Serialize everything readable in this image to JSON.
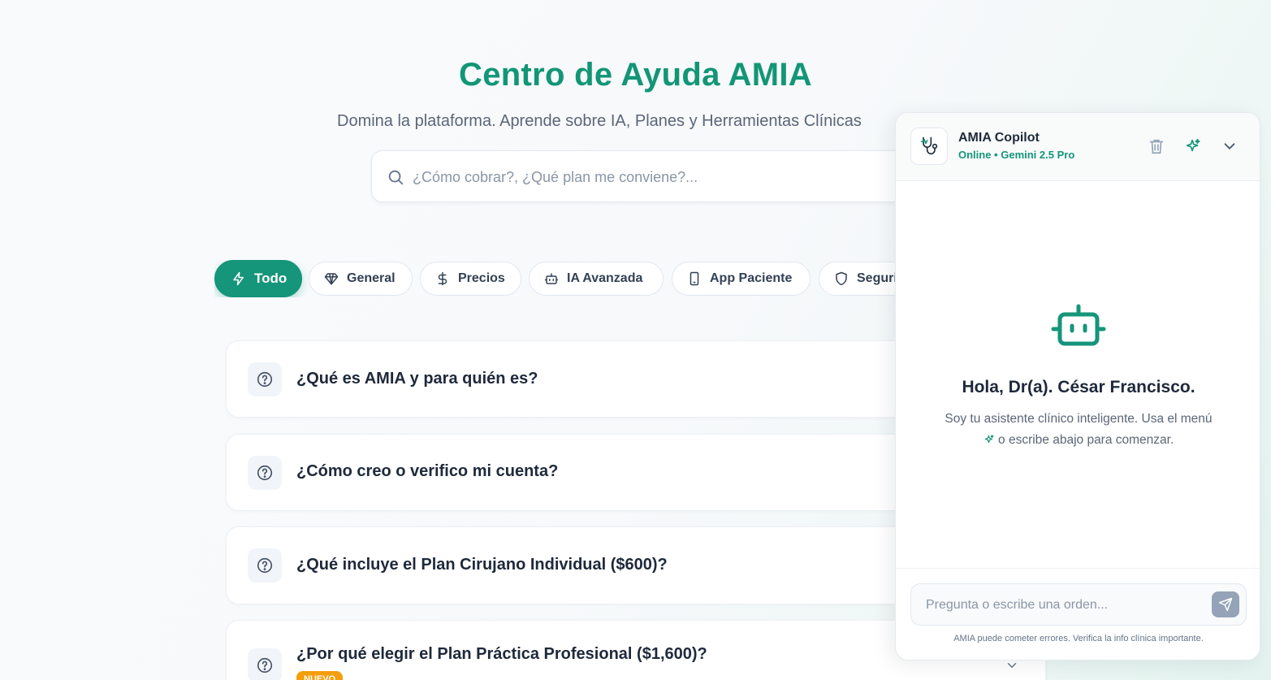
{
  "page": {
    "title": "Centro de Ayuda AMIA",
    "subtitle": "Domina la plataforma. Aprende sobre IA, Planes y Herramientas Clínicas",
    "search_placeholder": "¿Cómo cobrar?, ¿Qué plan me conviene?..."
  },
  "categories": [
    {
      "label": "Todo",
      "icon": "lightning-icon",
      "active": true
    },
    {
      "label": "General",
      "icon": "diamond-icon",
      "active": false
    },
    {
      "label": "Precios",
      "icon": "dollar-icon",
      "active": false
    },
    {
      "label": "IA Avanzada",
      "icon": "robot-icon",
      "active": false
    },
    {
      "label": "App Paciente",
      "icon": "smartphone-icon",
      "active": false
    },
    {
      "label": "Seguridad",
      "icon": "shield-icon",
      "active": false
    }
  ],
  "faqs": [
    {
      "question": "¿Qué es AMIA y para quién es?"
    },
    {
      "question": "¿Cómo creo o verifico mi cuenta?"
    },
    {
      "question": "¿Qué incluye el Plan Cirujano Individual ($600)?"
    },
    {
      "question": "¿Por qué elegir el Plan Práctica Profesional ($1,600)?",
      "badge": "NUEVO"
    }
  ],
  "copilot": {
    "title": "AMIA Copilot",
    "status": "Online • Gemini 2.5 Pro",
    "greeting": "Hola, Dr(a). César Francisco.",
    "intro_before": "Soy tu asistente clínico inteligente. Usa el menú",
    "intro_after": "o escribe abajo para comenzar.",
    "input_placeholder": "Pregunta o escribe una orden...",
    "disclaimer": "AMIA puede cometer errores. Verifica la info clínica importante."
  },
  "colors": {
    "accent": "#15957a",
    "badge": "#f59e0b"
  }
}
